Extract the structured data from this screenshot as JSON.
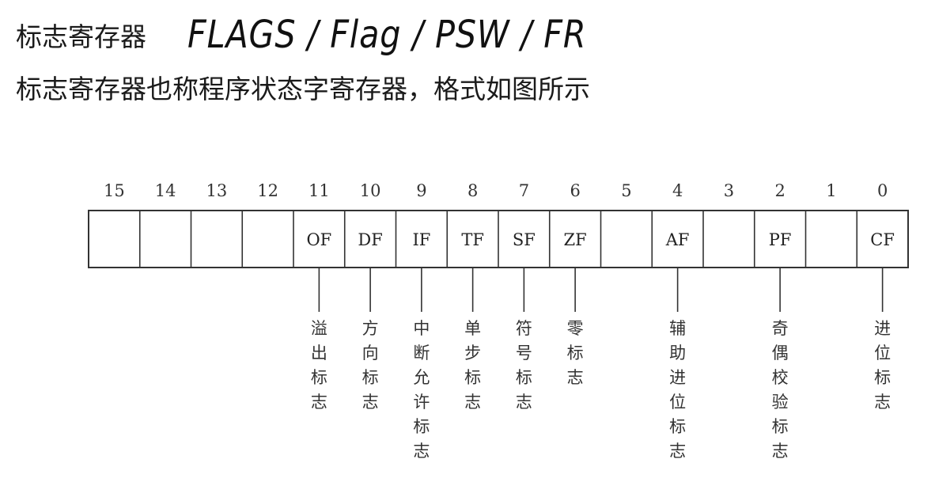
{
  "heading": {
    "title": "标志寄存器",
    "handwritten": "FLAGS / Flag / PSW / FR"
  },
  "subtitle": "标志寄存器也称程序状态字寄存器，格式如图所示",
  "register": {
    "bits": [
      {
        "bit": "15",
        "flag": "",
        "desc": ""
      },
      {
        "bit": "14",
        "flag": "",
        "desc": ""
      },
      {
        "bit": "13",
        "flag": "",
        "desc": ""
      },
      {
        "bit": "12",
        "flag": "",
        "desc": ""
      },
      {
        "bit": "11",
        "flag": "OF",
        "desc": "溢出标志"
      },
      {
        "bit": "10",
        "flag": "DF",
        "desc": "方向标志"
      },
      {
        "bit": "9",
        "flag": "IF",
        "desc": "中断允许标志"
      },
      {
        "bit": "8",
        "flag": "TF",
        "desc": "单步标志"
      },
      {
        "bit": "7",
        "flag": "SF",
        "desc": "符号标志"
      },
      {
        "bit": "6",
        "flag": "ZF",
        "desc": "零标志"
      },
      {
        "bit": "5",
        "flag": "",
        "desc": ""
      },
      {
        "bit": "4",
        "flag": "AF",
        "desc": "辅助进位标志"
      },
      {
        "bit": "3",
        "flag": "",
        "desc": ""
      },
      {
        "bit": "2",
        "flag": "PF",
        "desc": "奇偶校验标志"
      },
      {
        "bit": "1",
        "flag": "",
        "desc": ""
      },
      {
        "bit": "0",
        "flag": "CF",
        "desc": "进位标志"
      }
    ]
  }
}
